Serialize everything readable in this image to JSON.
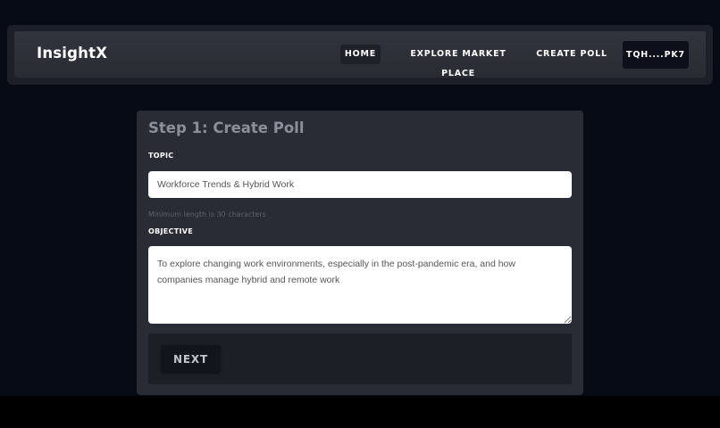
{
  "nav": {
    "brand": "InsightX",
    "links": [
      {
        "label": "HOME"
      },
      {
        "label": "EXPLORE MARKET PLACE"
      },
      {
        "label": "CREATE POLL"
      }
    ],
    "wallet": "TQH....PK7"
  },
  "form": {
    "title": "Step 1: Create Poll",
    "topic": {
      "label": "TOPIC",
      "value": "Workforce Trends & Hybrid Work",
      "hint": "Minimum length is 30 characters"
    },
    "objective": {
      "label": "OBJECTIVE",
      "value": "To explore changing work environments, especially in the post-pandemic era, and how companies manage hybrid and remote work"
    },
    "next_label": "NEXT"
  },
  "colors": {
    "page_bg": "#070b16",
    "card_bg": "#292b35",
    "nav_bg": "#2a2c34",
    "wallet_bg": "#0d0f1a"
  }
}
